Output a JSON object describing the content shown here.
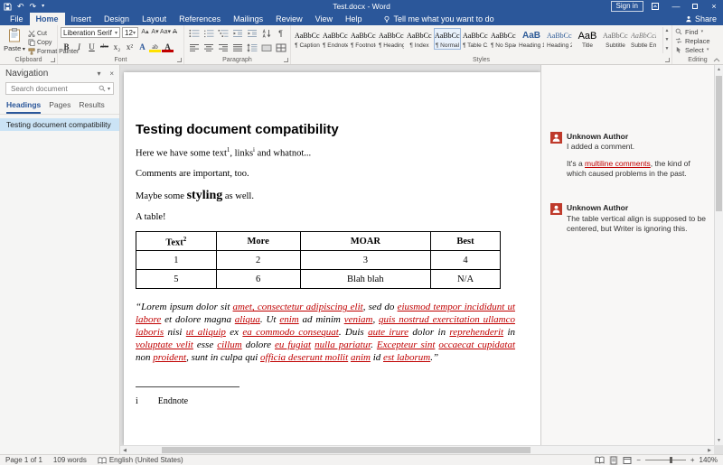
{
  "colors": {
    "titlebar": "#2b579a",
    "accent": "#2b579a",
    "track_change_red": "#c00000",
    "comment_red": "#bf3a2b",
    "selection_blue": "#cbe3f5"
  },
  "titlebar": {
    "title": "Test.docx - Word",
    "sign_in": "Sign in",
    "undo_glyph": "↶",
    "redo_glyph": "↷"
  },
  "ribbon_tabs": {
    "items": [
      "File",
      "Home",
      "Insert",
      "Design",
      "Layout",
      "References",
      "Mailings",
      "Review",
      "View",
      "Help"
    ],
    "active": "Home",
    "tell_me": "Tell me what you want to do",
    "share": "Share"
  },
  "ribbon": {
    "clipboard": {
      "label": "Clipboard",
      "paste": "Paste",
      "cut": "Cut",
      "copy": "Copy",
      "format_painter": "Format Painter"
    },
    "font": {
      "label": "Font",
      "family": "Liberation Serif",
      "size": "12",
      "row1_buttons": [
        {
          "g": "A▴",
          "cls": "",
          "name": "grow-font-button"
        },
        {
          "g": "A▾",
          "cls": "",
          "name": "shrink-font-button"
        },
        {
          "g": "Aa▾",
          "cls": "",
          "name": "change-case-button"
        },
        {
          "g": "A",
          "cls": "fb-clear",
          "name": "clear-formatting-button"
        }
      ],
      "row2_buttons": [
        {
          "g": "B",
          "cls": "fb-bold",
          "name": "bold-button"
        },
        {
          "g": "I",
          "cls": "fb-italic",
          "name": "italic-button"
        },
        {
          "g": "U",
          "cls": "fb-underline",
          "name": "underline-button"
        },
        {
          "g": "abc",
          "cls": "fb-strike",
          "name": "strikethrough-button"
        },
        {
          "g": "x₂",
          "cls": "",
          "name": "subscript-button"
        },
        {
          "g": "x²",
          "cls": "",
          "name": "superscript-button"
        },
        {
          "g": "A",
          "cls": "fb-effects",
          "name": "text-effects-button"
        },
        {
          "g": "ab",
          "cls": "fb-highlight",
          "name": "text-highlight-color-button"
        },
        {
          "g": "A",
          "cls": "fb-fontcolor",
          "name": "font-color-button"
        }
      ]
    },
    "paragraph": {
      "label": "Paragraph"
    },
    "styles": {
      "label": "Styles",
      "items": [
        {
          "preview": "AaBbCcI",
          "name": "¶ Caption",
          "cls": ""
        },
        {
          "preview": "AaBbCcI",
          "name": "¶ Endnote C...",
          "cls": ""
        },
        {
          "preview": "AaBbCcI",
          "name": "¶ Footnote...",
          "cls": ""
        },
        {
          "preview": "AaBbCcI",
          "name": "¶ Heading",
          "cls": ""
        },
        {
          "preview": "AaBbCcI",
          "name": "¶ Index",
          "cls": ""
        },
        {
          "preview": "AaBbCcI",
          "name": "¶ Normal",
          "cls": "",
          "selected": true
        },
        {
          "preview": "AaBbCcI",
          "name": "¶ Table C...",
          "cls": ""
        },
        {
          "preview": "AaBbCcI",
          "name": "¶ No Spac...",
          "cls": ""
        },
        {
          "preview": "AaB",
          "name": "Heading 1",
          "cls": "sp-h1"
        },
        {
          "preview": "AaBbCcI",
          "name": "Heading 2",
          "cls": "sp-h2"
        },
        {
          "preview": "AaB",
          "name": "Title",
          "cls": "sp-title"
        },
        {
          "preview": "AaBbCcI",
          "name": "Subtitle",
          "cls": "sp-subtitle"
        },
        {
          "preview": "AaBbCcI",
          "name": "Subtle Em...",
          "cls": "sp-subtle"
        }
      ]
    },
    "editing": {
      "label": "Editing",
      "find": "Find",
      "replace": "Replace",
      "select": "Select"
    }
  },
  "navigation": {
    "title": "Navigation",
    "search_placeholder": "Search document",
    "tabs": [
      "Headings",
      "Pages",
      "Results"
    ],
    "active_tab": "Headings",
    "items": [
      "Testing document compatibility"
    ]
  },
  "document": {
    "heading": "Testing document compatibility",
    "para1": [
      {
        "t": "Here we have some text"
      },
      {
        "t": "1",
        "sup": true
      },
      {
        "t": ", "
      },
      {
        "t": "links"
      },
      {
        "t": "i",
        "sup": true
      },
      {
        "t": " and whatnot..."
      }
    ],
    "para2": "Comments are important, too.",
    "para3": [
      {
        "t": "Maybe some "
      },
      {
        "t": "styling",
        "big_bold": true
      },
      {
        "t": " as well."
      }
    ],
    "para4": "A table!",
    "table": {
      "headers": [
        {
          "t": "Text",
          "sup": "2"
        },
        {
          "t": "More"
        },
        {
          "t": "MOAR"
        },
        {
          "t": "Best"
        }
      ],
      "rows": [
        [
          "1",
          "2",
          "3",
          "4"
        ],
        [
          "5",
          "6",
          "Blah blah",
          "N/A"
        ]
      ]
    },
    "lorem": [
      {
        "t": "“Lorem ipsum dolor sit ",
        "r": 0
      },
      {
        "t": "amet, consectetur adipiscing elit",
        "r": 1
      },
      {
        "t": ", sed do ",
        "r": 0
      },
      {
        "t": "eiusmod tempor incididunt ut labore",
        "r": 1
      },
      {
        "t": " et dolore magna ",
        "r": 0
      },
      {
        "t": "aliqua",
        "r": 1
      },
      {
        "t": ". Ut ",
        "r": 0
      },
      {
        "t": "enim",
        "r": 1
      },
      {
        "t": " ad minim ",
        "r": 0
      },
      {
        "t": "veniam",
        "r": 1
      },
      {
        "t": ", ",
        "r": 0
      },
      {
        "t": "quis nostrud exercitation ullamco laboris",
        "r": 1
      },
      {
        "t": " nisi ",
        "r": 0
      },
      {
        "t": "ut aliquip",
        "r": 1
      },
      {
        "t": " ex ",
        "r": 0
      },
      {
        "t": "ea commodo consequat",
        "r": 1
      },
      {
        "t": ". Duis ",
        "r": 0
      },
      {
        "t": "aute irure",
        "r": 1
      },
      {
        "t": " dolor in ",
        "r": 0
      },
      {
        "t": "reprehenderit",
        "r": 1
      },
      {
        "t": " in ",
        "r": 0
      },
      {
        "t": "voluptate velit",
        "r": 1
      },
      {
        "t": " esse ",
        "r": 0
      },
      {
        "t": "cillum",
        "r": 1
      },
      {
        "t": " dolore ",
        "r": 0
      },
      {
        "t": "eu fugiat",
        "r": 1
      },
      {
        "t": " ",
        "r": 0
      },
      {
        "t": "nulla pariatur",
        "r": 1
      },
      {
        "t": ". ",
        "r": 0
      },
      {
        "t": "Excepteur sint",
        "r": 1
      },
      {
        "t": " ",
        "r": 0
      },
      {
        "t": "occaecat cupidatat",
        "r": 1
      },
      {
        "t": " non ",
        "r": 0
      },
      {
        "t": "proident",
        "r": 1
      },
      {
        "t": ", sunt in culpa qui ",
        "r": 0
      },
      {
        "t": "officia deserunt mollit",
        "r": 1
      },
      {
        "t": " ",
        "r": 0
      },
      {
        "t": "anim",
        "r": 1
      },
      {
        "t": " id ",
        "r": 0
      },
      {
        "t": "est laborum",
        "r": 1
      },
      {
        "t": ".”",
        "r": 0
      }
    ],
    "endnote": {
      "marker": "i",
      "text": "Endnote"
    }
  },
  "comments": {
    "items": [
      {
        "author": "Unknown Author",
        "paras": [
          [
            {
              "t": "I added a comment."
            }
          ],
          [
            {
              "t": "It's a "
            },
            {
              "t": "multiline comments",
              "red": true
            },
            {
              "t": ", the kind of which caused problems in the past."
            }
          ]
        ]
      },
      {
        "author": "Unknown Author",
        "paras": [
          [
            {
              "t": "The table vertical align is supposed to be centered, but Writer is ignoring this."
            }
          ]
        ]
      }
    ]
  },
  "status_bar": {
    "page": "Page 1 of 1",
    "words": "109 words",
    "language": "English (United States)",
    "zoom": "140%"
  }
}
